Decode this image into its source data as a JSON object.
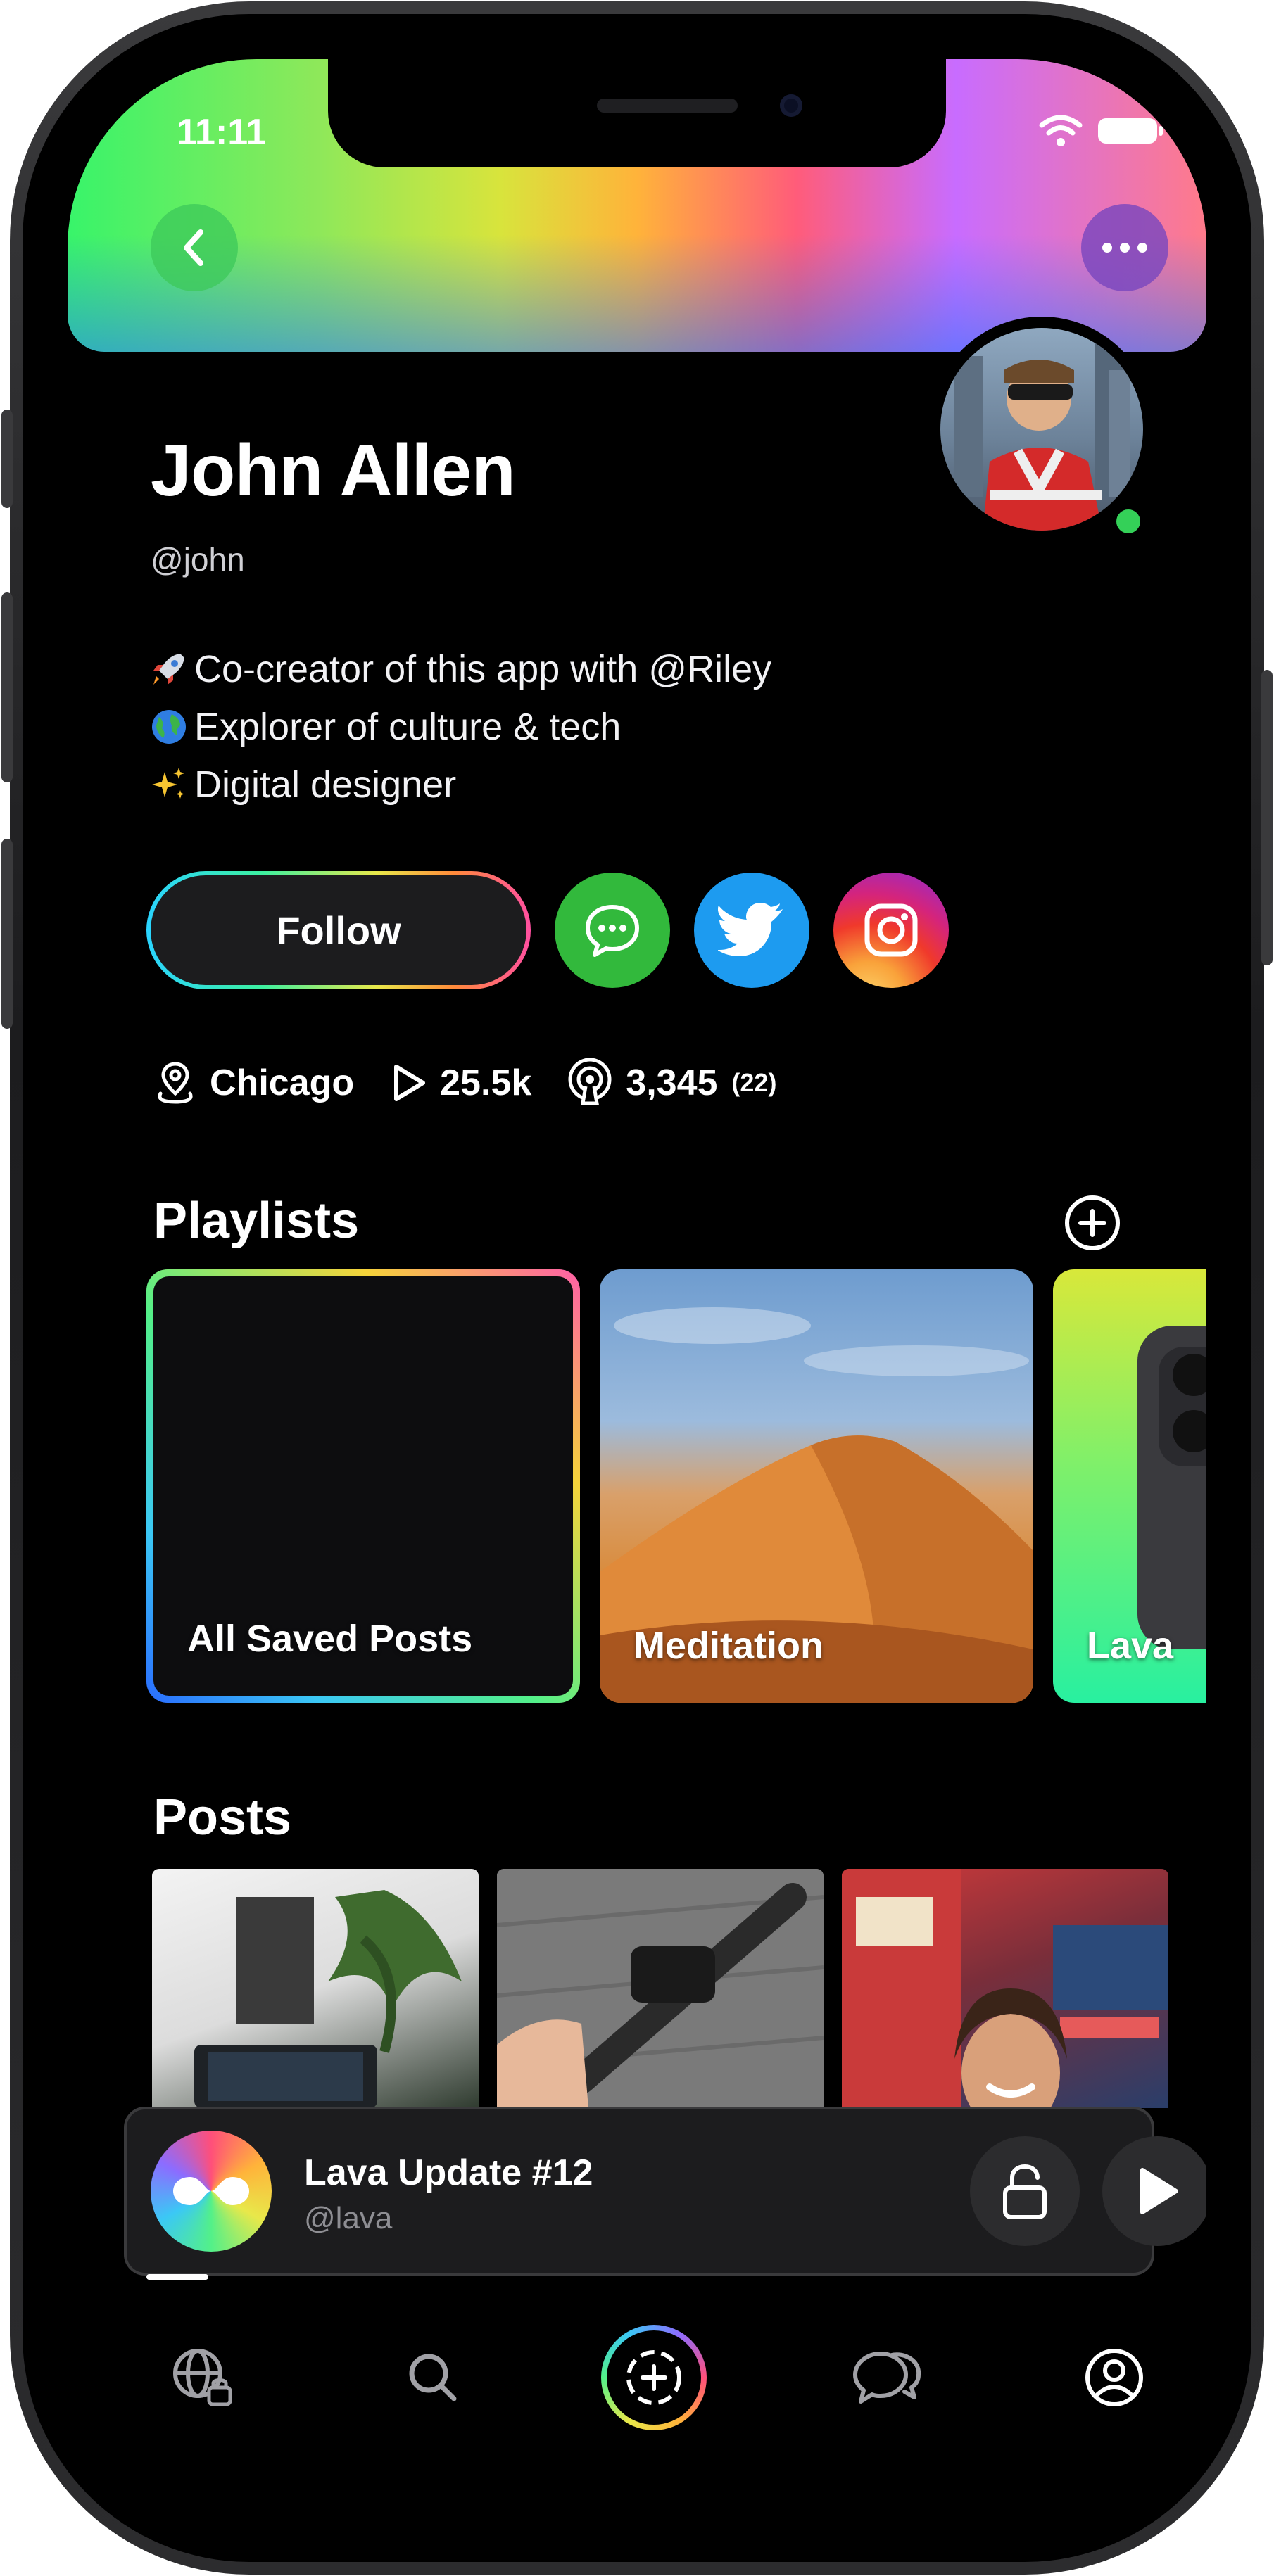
{
  "status_bar": {
    "time": "11:11"
  },
  "profile": {
    "name": "John Allen",
    "handle": "@john",
    "bio": [
      {
        "emoji": "rocket-icon",
        "text": "Co-creator of this app with @Riley"
      },
      {
        "emoji": "globe-icon",
        "text": "Explorer of culture & tech"
      },
      {
        "emoji": "sparkles-icon",
        "text": "Digital designer"
      }
    ],
    "follow_label": "Follow",
    "stats": {
      "location": "Chicago",
      "plays": "25.5k",
      "listeners": "3,345",
      "listeners_sub": "(22)"
    }
  },
  "playlists": {
    "title": "Playlists",
    "items": [
      {
        "label": "All Saved Posts"
      },
      {
        "label": "Meditation"
      },
      {
        "label": "Lava"
      }
    ]
  },
  "posts": {
    "title": "Posts"
  },
  "mini_player": {
    "title": "Lava Update #12",
    "subtitle": "@lava",
    "progress": 0.06
  },
  "colors": {
    "accent_green": "#34d058",
    "twitter_blue": "#1d9bf0",
    "message_green": "#32b93c",
    "background": "#000000"
  }
}
